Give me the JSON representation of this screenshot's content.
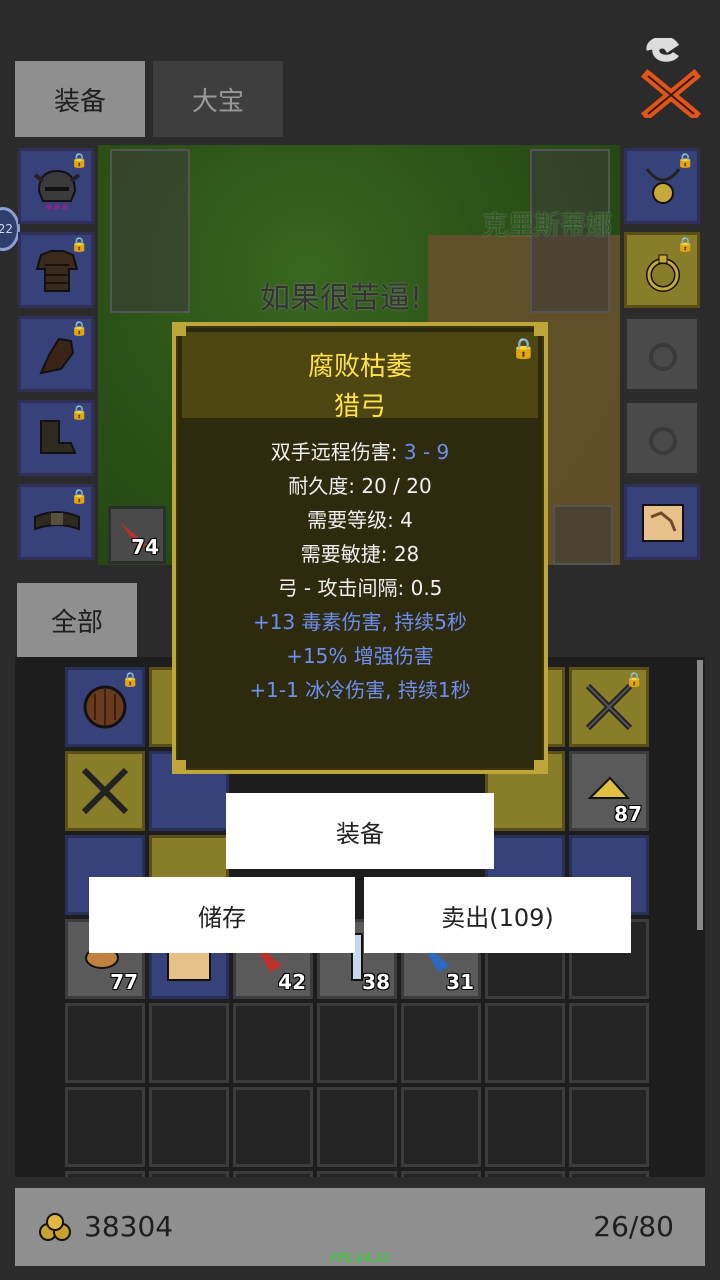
{
  "tabs": {
    "equipment": "装备",
    "treasure": "大宝"
  },
  "icons": {
    "close": "close-x-icon",
    "gold": "gold-coins-icon",
    "lock": "lock-icon"
  },
  "level_badge": "22",
  "scene": {
    "overlay_text": "如果很苦逼!",
    "npc_name": "克里斯蒂娜"
  },
  "equipment_slots": {
    "left": [
      {
        "icon": "horned-helmet-icon",
        "locked": true
      },
      {
        "icon": "leather-armor-icon",
        "locked": true
      },
      {
        "icon": "gloves-icon",
        "locked": true
      },
      {
        "icon": "boots-icon",
        "locked": true
      },
      {
        "icon": "belt-icon",
        "locked": true
      }
    ],
    "right": [
      {
        "icon": "amulet-icon",
        "locked": true
      },
      {
        "icon": "ring-icon",
        "locked": true
      },
      {
        "icon": "ring-empty-icon",
        "locked": false
      },
      {
        "icon": "ring-empty-icon",
        "locked": false
      },
      {
        "icon": "scroll-map-icon",
        "locked": false
      }
    ],
    "potion_count": "74"
  },
  "tooltip": {
    "item_name": "腐败枯萎",
    "item_type": "猎弓",
    "stats": [
      {
        "label": "双手远程伤害: ",
        "value": "3 - 9"
      },
      {
        "label": "耐久度: 20 / 20"
      },
      {
        "label": "需要等级: 4"
      },
      {
        "label": "需要敏捷: 28"
      },
      {
        "label": "弓 - 攻击间隔: 0.5"
      }
    ],
    "affixes": [
      "+13 毒素伤害, 持续5秒",
      "+15% 增强伤害",
      "+1-1 冰冷伤害, 持续1秒"
    ]
  },
  "actions": {
    "equip": "装备",
    "store": "储存",
    "sell": "卖出(109)"
  },
  "inventory": {
    "filter": "全部",
    "counts": {
      "right_item": "87",
      "food": "77",
      "red": "42",
      "bottle": "38",
      "blue": "31"
    }
  },
  "footer": {
    "gold": "38304",
    "capacity": "26/80"
  },
  "fps": "FPS:24.23",
  "colors": {
    "slot_blue": "#38427a",
    "slot_yellow": "#8a7d2a",
    "tooltip_title": "#ffe14a",
    "affix_blue": "#6e8ff0"
  }
}
